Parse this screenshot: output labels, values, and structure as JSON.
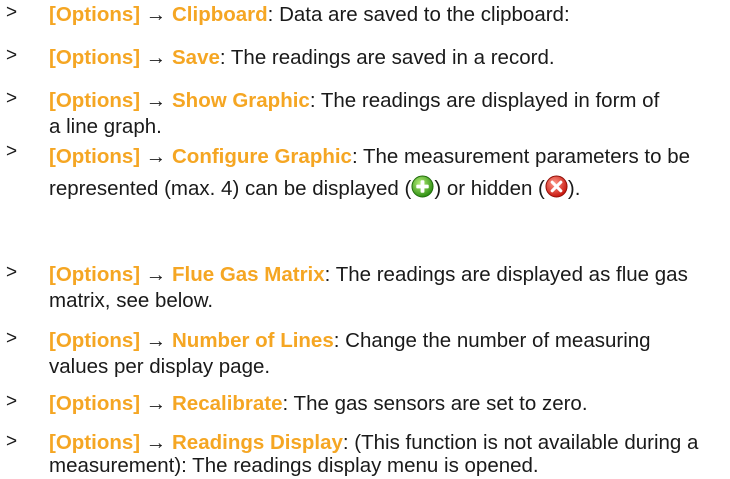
{
  "bullet_glyph": ">",
  "arrow_glyph": "→",
  "accent_color": "#f5a623",
  "items": [
    {
      "option": "[Options]",
      "function": "Clipboard",
      "text": ": Data are saved to the clipboard:"
    },
    {
      "option": "[Options]",
      "function": "Save",
      "text": ": The readings are saved in a record."
    },
    {
      "option": "[Options]",
      "function": "Show Graphic",
      "text": ": The readings are displayed in form of a line graph."
    },
    {
      "option": "[Options]",
      "function": "Configure Graphic",
      "text_1": ": The measurement parameters to be represented (max. 4) can be displayed (",
      "text_2": ") or hidden (",
      "text_3": ").",
      "icon_show": "plus-circle-green-icon",
      "icon_hide": "x-circle-red-icon"
    },
    {
      "option": "[Options]",
      "function": "Flue Gas Matrix",
      "text": ": The readings are displayed as flue gas matrix, see below."
    },
    {
      "option": "[Options]",
      "function": "Number of Lines",
      "text": ": Change the number of measuring values per display page."
    },
    {
      "option": "[Options]",
      "function": "Recalibrate",
      "text": ": The gas sensors are set to zero."
    },
    {
      "option": "[Options]",
      "function": "Readings Display",
      "text": ": (This function is not available during a measurement): The readings display menu is opened."
    }
  ]
}
